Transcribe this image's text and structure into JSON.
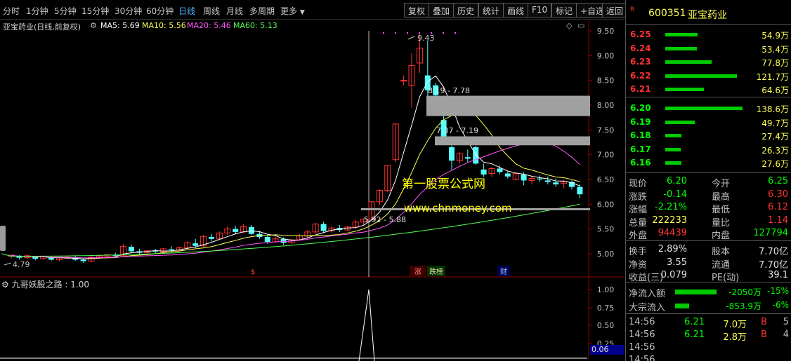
{
  "toolbar": {
    "periods": [
      "分时",
      "1分钟",
      "5分钟",
      "15分钟",
      "30分钟",
      "60分钟",
      "日线",
      "周线",
      "月线",
      "多周期",
      "更多"
    ],
    "active_period": "日线",
    "buttons": [
      "复权",
      "叠加",
      "历史",
      "统计",
      "画线",
      "F10",
      "标记",
      "+自选",
      "返回"
    ]
  },
  "stock": {
    "name_line": "亚宝药业(日线,前复权)",
    "ma5_label": "MA5: 5.69",
    "ma10_label": "MA10: 5.56",
    "ma20_label": "MA20: 5.46",
    "ma60_label": "MA60: 5.13",
    "code": "600351",
    "name": "亚宝药业",
    "tag": "R"
  },
  "colors": {
    "up": "#ff3232",
    "down": "#54ffff",
    "ma5": "#ffffff",
    "ma10": "#ffff55",
    "ma20": "#ff55ff",
    "ma60": "#55ff55",
    "buy_bar": "#00cc00",
    "active": "#4db6ff"
  },
  "chart_data": {
    "type": "candlestick",
    "y_ticks": [
      "9.50",
      "9.00",
      "8.50",
      "8.00",
      "7.50",
      "7.00",
      "6.50",
      "6.00",
      "5.50",
      "5.00"
    ],
    "ylim": [
      4.55,
      9.6
    ],
    "annotations": {
      "high": "9.43",
      "low": "4.79",
      "gap1": "8.19 - 7.78",
      "gap2": "7.37 - 7.19",
      "gap3": "5.92 - 5.88",
      "watermark1": "第一股票公式网",
      "watermark2": "www.chnmoney.com"
    },
    "markers": [
      "$",
      "涨",
      "跌榜",
      "财"
    ],
    "candles": [
      [
        4.95,
        4.98,
        4.9,
        4.97
      ],
      [
        4.96,
        4.97,
        4.88,
        4.92
      ],
      [
        4.92,
        4.98,
        4.9,
        4.96
      ],
      [
        4.95,
        4.96,
        4.87,
        4.9
      ],
      [
        4.9,
        4.96,
        4.88,
        4.94
      ],
      [
        4.93,
        4.95,
        4.86,
        4.88
      ],
      [
        4.88,
        4.94,
        4.85,
        4.92
      ],
      [
        4.91,
        4.95,
        4.88,
        4.93
      ],
      [
        4.92,
        4.96,
        4.86,
        4.88
      ],
      [
        4.88,
        4.92,
        4.82,
        4.85
      ],
      [
        4.85,
        4.95,
        4.83,
        4.93
      ],
      [
        4.93,
        4.98,
        4.9,
        4.96
      ],
      [
        4.95,
        5.0,
        4.92,
        4.98
      ],
      [
        4.98,
        5.02,
        4.93,
        4.96
      ],
      [
        4.96,
        5.2,
        4.94,
        5.15
      ],
      [
        5.14,
        5.18,
        5.02,
        5.05
      ],
      [
        5.05,
        5.1,
        4.98,
        5.02
      ],
      [
        5.02,
        5.08,
        4.99,
        5.06
      ],
      [
        5.05,
        5.1,
        5.0,
        5.04
      ],
      [
        5.04,
        5.12,
        5.02,
        5.1
      ],
      [
        5.09,
        5.15,
        5.04,
        5.07
      ],
      [
        5.07,
        5.14,
        5.05,
        5.12
      ],
      [
        5.12,
        5.25,
        5.1,
        5.22
      ],
      [
        5.21,
        5.3,
        5.12,
        5.16
      ],
      [
        5.16,
        5.38,
        5.14,
        5.35
      ],
      [
        5.34,
        5.4,
        5.25,
        5.3
      ],
      [
        5.3,
        5.45,
        5.28,
        5.42
      ],
      [
        5.42,
        5.55,
        5.38,
        5.5
      ],
      [
        5.5,
        5.56,
        5.4,
        5.44
      ],
      [
        5.44,
        5.6,
        5.42,
        5.55
      ],
      [
        5.54,
        5.58,
        5.38,
        5.4
      ],
      [
        5.4,
        5.46,
        5.3,
        5.34
      ],
      [
        5.34,
        5.38,
        5.2,
        5.24
      ],
      [
        5.24,
        5.34,
        5.22,
        5.3
      ],
      [
        5.3,
        5.33,
        5.18,
        5.22
      ],
      [
        5.22,
        5.3,
        5.2,
        5.28
      ],
      [
        5.28,
        5.4,
        5.26,
        5.36
      ],
      [
        5.36,
        5.48,
        5.3,
        5.44
      ],
      [
        5.44,
        5.62,
        5.4,
        5.6
      ],
      [
        5.6,
        5.65,
        5.42,
        5.46
      ],
      [
        5.46,
        5.56,
        5.42,
        5.52
      ],
      [
        5.52,
        5.58,
        5.44,
        5.48
      ],
      [
        5.48,
        5.56,
        5.46,
        5.54
      ],
      [
        5.54,
        5.68,
        5.5,
        5.64
      ],
      [
        5.64,
        5.72,
        5.58,
        5.7
      ],
      [
        5.7,
        6.05,
        5.68,
        6.05
      ],
      [
        6.05,
        6.3,
        5.98,
        6.28
      ],
      [
        6.28,
        6.78,
        6.24,
        6.78
      ],
      [
        6.9,
        7.62,
        6.85,
        7.62
      ],
      [
        8.5,
        8.6,
        8.4,
        8.5
      ],
      [
        8.4,
        9.05,
        7.95,
        8.8
      ],
      [
        8.85,
        9.43,
        8.65,
        9.15
      ],
      [
        8.6,
        9.3,
        8.15,
        8.3
      ],
      [
        8.4,
        8.45,
        8.1,
        8.2
      ],
      [
        7.7,
        7.78,
        7.3,
        7.37
      ],
      [
        7.15,
        7.19,
        6.7,
        6.88
      ],
      [
        6.88,
        7.05,
        6.82,
        7.02
      ],
      [
        6.95,
        7.1,
        6.85,
        6.92
      ],
      [
        7.15,
        7.18,
        6.8,
        6.82
      ],
      [
        6.7,
        6.82,
        6.55,
        6.6
      ],
      [
        6.62,
        6.75,
        6.55,
        6.72
      ],
      [
        6.72,
        6.78,
        6.6,
        6.65
      ],
      [
        6.62,
        6.66,
        6.52,
        6.56
      ],
      [
        6.5,
        6.64,
        6.48,
        6.62
      ],
      [
        6.6,
        6.65,
        6.38,
        6.48
      ],
      [
        6.48,
        6.56,
        6.4,
        6.52
      ],
      [
        6.52,
        6.58,
        6.45,
        6.5
      ],
      [
        6.48,
        6.56,
        6.4,
        6.45
      ],
      [
        6.44,
        6.52,
        6.35,
        6.4
      ],
      [
        6.42,
        6.5,
        6.32,
        6.46
      ],
      [
        6.45,
        6.48,
        6.3,
        6.35
      ],
      [
        6.35,
        6.4,
        6.12,
        6.2
      ]
    ]
  },
  "indicator": {
    "label": "九哥妖股之路 : 1.00",
    "y_ticks": [
      "1.00",
      "0.75",
      "0.50",
      "0.25"
    ],
    "value_box": "0.06"
  },
  "order_book": [
    {
      "p": "6.25",
      "v": "54.9万",
      "w": 0.42
    },
    {
      "p": "6.24",
      "v": "53.4万",
      "w": 0.41
    },
    {
      "p": "6.23",
      "v": "77.8万",
      "w": 0.6
    },
    {
      "p": "6.22",
      "v": "121.7万",
      "w": 0.93
    },
    {
      "p": "6.21",
      "v": "64.6万",
      "w": 0.5
    },
    {
      "p": "6.20",
      "v": "138.6万",
      "w": 1.0
    },
    {
      "p": "6.19",
      "v": "49.7万",
      "w": 0.38
    },
    {
      "p": "6.18",
      "v": "27.4万",
      "w": 0.21
    },
    {
      "p": "6.17",
      "v": "26.3万",
      "w": 0.2
    },
    {
      "p": "6.16",
      "v": "27.6万",
      "w": 0.21
    }
  ],
  "quote": [
    [
      "现价",
      "6.20",
      "今开",
      "6.25"
    ],
    [
      "涨跌",
      "-0.14",
      "最高",
      "6.30"
    ],
    [
      "涨幅",
      "-2.21%",
      "最低",
      "6.12"
    ],
    [
      "总量",
      "222233",
      "量比",
      "1.14"
    ],
    [
      "外盘",
      "94439",
      "内盘",
      "127794"
    ]
  ],
  "fund": [
    [
      "换手",
      "2.89%",
      "股本",
      "7.70亿"
    ],
    [
      "净资",
      "3.55",
      "流通",
      "7.70亿"
    ],
    [
      "收益(三)",
      "0.079",
      "PE(动)",
      "39.1"
    ]
  ],
  "flow": [
    {
      "label": "净流入额",
      "value": "-2050万",
      "pct": "-15%",
      "w": 0.9
    },
    {
      "label": "大宗流入",
      "value": "-853.9万",
      "pct": "-6%",
      "w": 0.3
    }
  ],
  "ticks": [
    [
      "14:56",
      "6.21",
      "7.0万",
      "B",
      "5"
    ],
    [
      "14:56",
      "6.21",
      "2.8万",
      "B",
      "4"
    ],
    [
      "14:56",
      "",
      "",
      "",
      ""
    ],
    [
      "14:56",
      "",
      "",
      "",
      ""
    ]
  ]
}
